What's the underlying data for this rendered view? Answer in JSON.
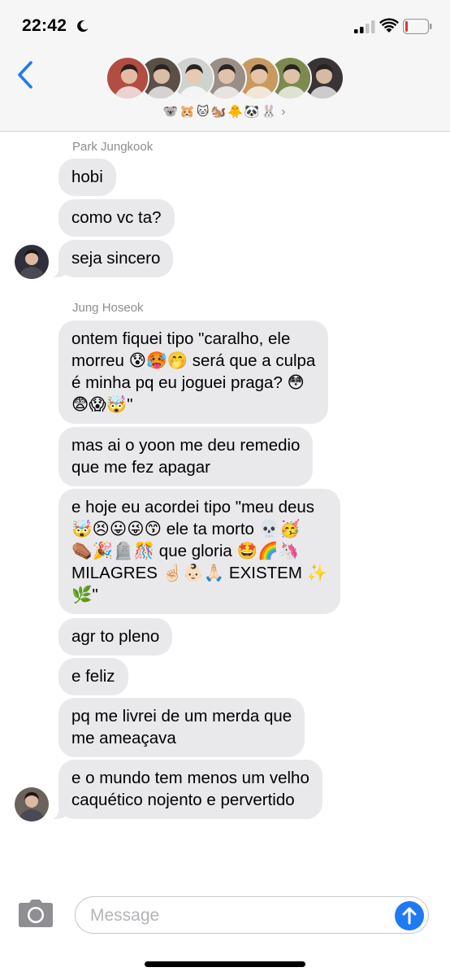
{
  "status_bar": {
    "time": "22:42"
  },
  "header": {
    "group_name": "🐨🐹🐱🐿️🐥🐼🐰",
    "chevron": "›",
    "avatar_colors": [
      "#b24d44",
      "#5a5048",
      "#cfd3cf",
      "#9a8f86",
      "#c79a62",
      "#7d8a4f",
      "#3a3436"
    ]
  },
  "messages": [
    {
      "sender": "Park Jungkook",
      "avatar_color": "#2e2f3a",
      "bubbles": [
        "hobi",
        "como vc ta?",
        "seja sincero"
      ]
    },
    {
      "sender": "Jung Hoseok",
      "avatar_color": "#6b625c",
      "bubbles": [
        [
          "ontem fiquei tipo \"caralho, ele",
          "morreu 😰🥵🤭 será que a culpa",
          "é minha pq eu joguei praga? 😳",
          "😨😱🤯\""
        ],
        [
          "mas ai o yoon me deu remedio",
          "que me fez apagar"
        ],
        [
          "e hoje eu acordei tipo \"meu deus",
          "🤯😣😛😜😙 ele ta morto 💀🥳",
          "⚰️🎉🪦🎊 que gloria 🤩🌈🦄",
          "MILAGRES ☝🏻👶🏻🙏🏻 EXISTEM ✨",
          "🌿\""
        ],
        [
          "agr to pleno"
        ],
        [
          "e feliz"
        ],
        [
          "pq me livrei de um merda que",
          "me ameaçava"
        ],
        [
          "e o mundo tem menos um velho",
          "caquético nojento e pervertido"
        ]
      ]
    }
  ],
  "input": {
    "placeholder": "Message"
  },
  "colors": {
    "accent": "#1f7af4",
    "bubble": "#e9e9eb",
    "header_bg": "#f6f6f6"
  }
}
